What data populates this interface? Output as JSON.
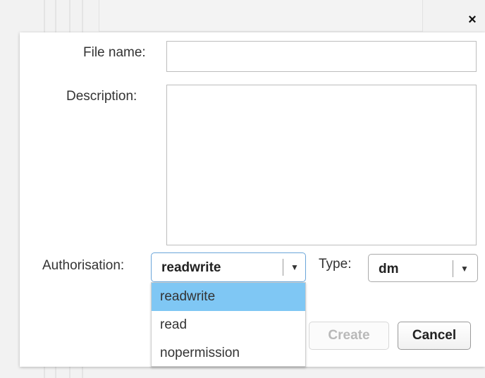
{
  "dialog": {
    "close_glyph": "×",
    "file_name_label": "File name:",
    "file_name_value": "",
    "description_label": "Description:",
    "description_value": "",
    "authorisation_label": "Authorisation:",
    "authorisation_value": "readwrite",
    "authorisation_options": [
      "readwrite",
      "read",
      "nopermission"
    ],
    "type_label": "Type:",
    "type_value": "dm",
    "create_label": "Create",
    "cancel_label": "Cancel"
  },
  "icons": {
    "close": "close-icon",
    "dropdown_arrow": "chevron-down-icon"
  },
  "colors": {
    "selected_option_bg": "#7fc7f4",
    "focused_select_border": "#6aa5d9",
    "disabled_text": "#b9b9b9"
  }
}
